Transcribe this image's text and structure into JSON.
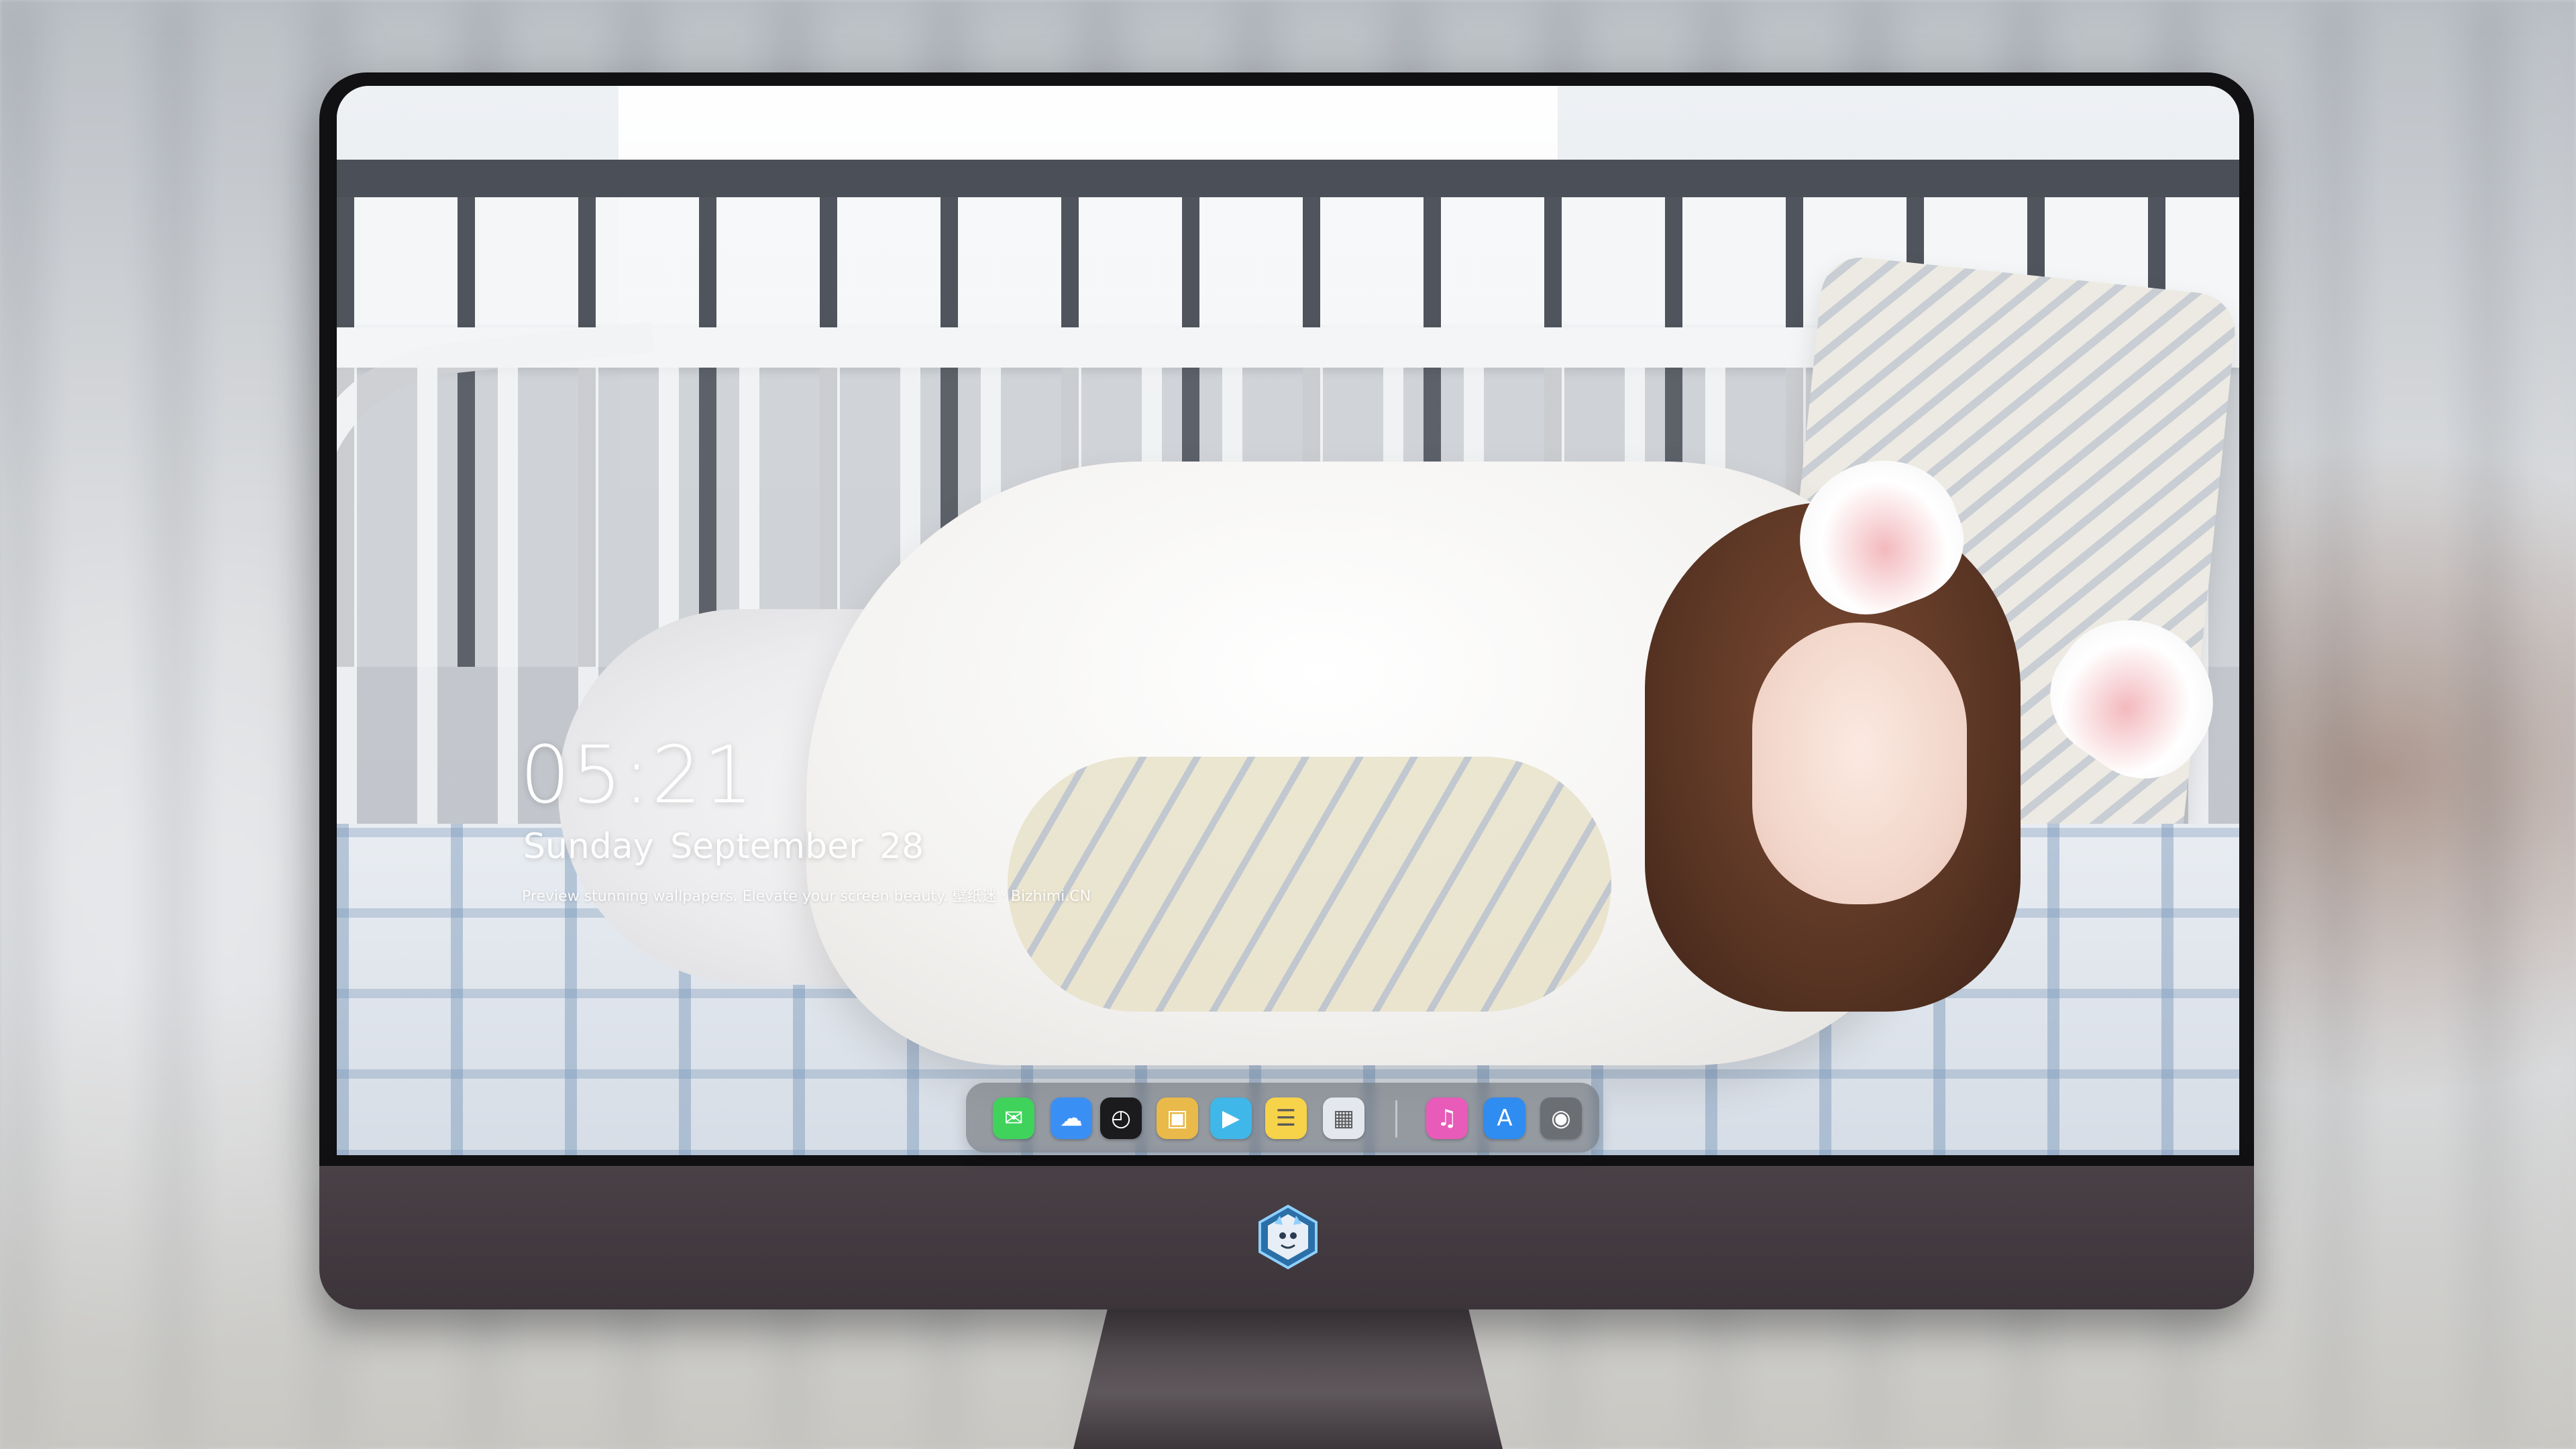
{
  "lockscreen": {
    "time": "05:21",
    "date": "Sunday  September  28",
    "tagline": "Preview stunning wallpapers. Elevate your screen beauty. 壁纸迷 · Bizhimi.CN"
  },
  "dock": {
    "apps": [
      {
        "name": "Messages",
        "icon": "messages-icon",
        "glyph": "✉",
        "color": "#3fd35b"
      },
      {
        "name": "Weather",
        "icon": "weather-icon",
        "glyph": "☁",
        "color": "#3a8ff5"
      },
      {
        "name": "Clock",
        "icon": "clock-icon",
        "glyph": "◴",
        "color": "#1b1b1d"
      },
      {
        "name": "Preview",
        "icon": "preview-icon",
        "glyph": "▣",
        "color": "#e9b94a"
      },
      {
        "name": "Clips",
        "icon": "clapperboard-icon",
        "glyph": "▶",
        "color": "#3fb7e8"
      },
      {
        "name": "Notes",
        "icon": "notes-icon",
        "glyph": "☰",
        "color": "#f7d34a"
      },
      {
        "name": "Photo Booth",
        "icon": "photo-grid-icon",
        "glyph": "▦",
        "color": "#e4e8ee"
      },
      {
        "name": "iTunes",
        "icon": "music-note-icon",
        "glyph": "♫",
        "color": "#e85bb8"
      },
      {
        "name": "App Store",
        "icon": "app-store-icon",
        "glyph": "A",
        "color": "#2f8cf0"
      },
      {
        "name": "Camera",
        "icon": "camera-icon",
        "glyph": "◉",
        "color": "#6b6e73"
      }
    ]
  },
  "colors": {
    "bezel": "#111113",
    "chin": "#443c42",
    "dock_bg": "#5f6268"
  }
}
